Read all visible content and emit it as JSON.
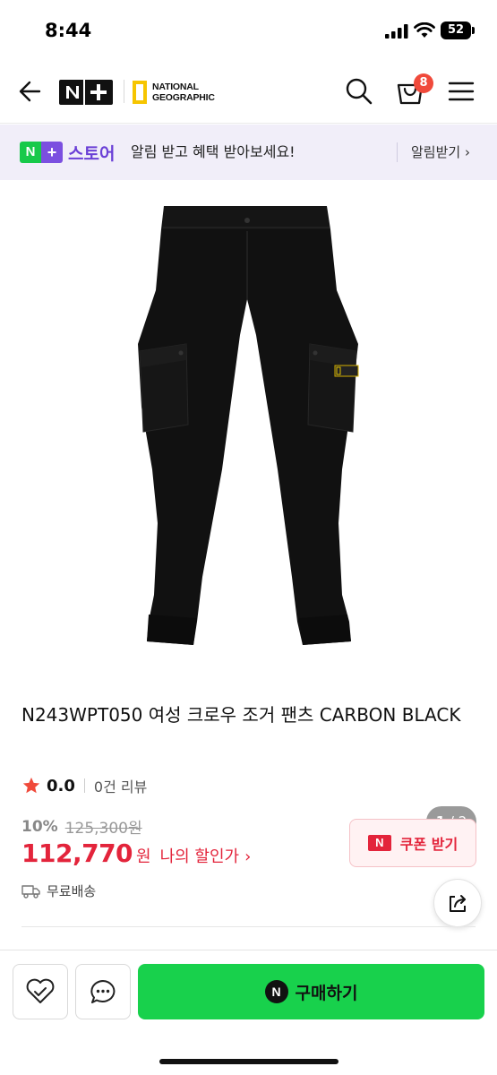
{
  "status_bar": {
    "time": "8:44",
    "battery": "52"
  },
  "header": {
    "brand_logo": "N+",
    "partner_logo": [
      "NATIONAL",
      "GEOGRAPHIC"
    ],
    "cart_count": "8",
    "icons": [
      "back-arrow-icon",
      "search-icon",
      "cart-icon",
      "hamburger-menu-icon"
    ]
  },
  "store_banner": {
    "logo_n": "N",
    "logo_plus": "+",
    "store_label": "스토어",
    "message": "알림 받고 혜택 받아보세요!",
    "action": "알림받기 ›"
  },
  "gallery": {
    "current": "1",
    "separator": " / ",
    "total": "2"
  },
  "product": {
    "title": "N243WPT050 여성 크로우 조거 팬츠 CARBON BLACK",
    "rating": "0.0",
    "review_count": "0건 리뷰",
    "discount_rate": "10%",
    "original_price": "125,300원",
    "sale_price": "112,770",
    "currency": "원",
    "my_price_label": "나의 할인가",
    "my_price_arrow": "›",
    "coupon_icon": "N",
    "coupon_label": "쿠폰 받기",
    "shipping": "무료배송"
  },
  "bottom_bar": {
    "buy_icon": "N",
    "buy_label": "구매하기"
  },
  "colors": {
    "accent_green": "#18d14c",
    "price_red": "#e3243b",
    "store_purple": "#6a3fd6",
    "banner_bg": "#f1eef9"
  }
}
